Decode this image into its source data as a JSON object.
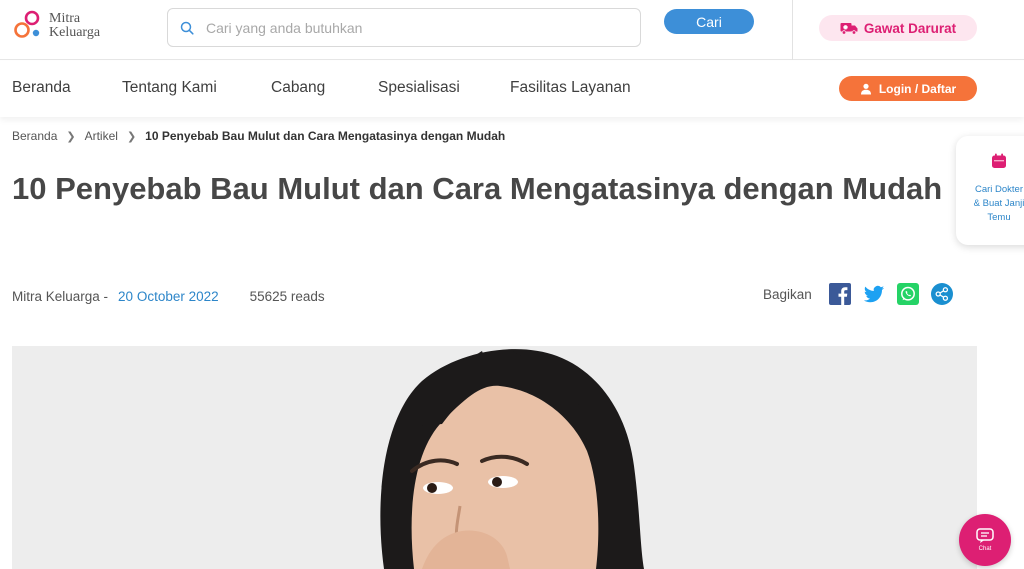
{
  "header": {
    "logo_line1": "Mitra",
    "logo_line2": "Keluarga",
    "search_placeholder": "Cari yang anda butuhkan",
    "search_value": "",
    "search_button": "Cari",
    "emergency_label": "Gawat Darurat"
  },
  "nav": {
    "items": [
      "Beranda",
      "Tentang Kami",
      "Cabang",
      "Spesialisasi",
      "Fasilitas Layanan"
    ],
    "login_label": "Login / Daftar"
  },
  "breadcrumb": {
    "items": [
      "Beranda",
      "Artikel"
    ],
    "current": "10 Penyebab Bau Mulut dan Cara Mengatasinya dengan Mudah"
  },
  "article": {
    "title": "10 Penyebab Bau Mulut dan Cara Mengatasinya dengan Mudah",
    "author": "Mitra Keluarga -",
    "date": "20 October 2022",
    "reads": "55625 reads",
    "share_label": "Bagikan"
  },
  "side_widget": {
    "line1": "Cari Dokter",
    "line2": "& Buat Janji",
    "line3": "Temu"
  },
  "chat": {
    "label": "Chat"
  },
  "colors": {
    "brand_pink": "#dd1f73",
    "accent_blue": "#3d8fd8",
    "login_orange": "#f5733a",
    "date_blue": "#2d86c9",
    "facebook": "#3b5998",
    "twitter": "#1da1f2",
    "whatsapp": "#25d366",
    "share_circle": "#1a8fd0"
  },
  "icons": {
    "search": "search-icon",
    "ambulance": "ambulance-icon",
    "user": "user-icon",
    "chevron": "chevron-right-icon",
    "facebook": "facebook-icon",
    "twitter": "twitter-icon",
    "whatsapp": "whatsapp-icon",
    "share": "share-icon",
    "calendar": "calendar-icon",
    "chat": "chat-icon"
  }
}
